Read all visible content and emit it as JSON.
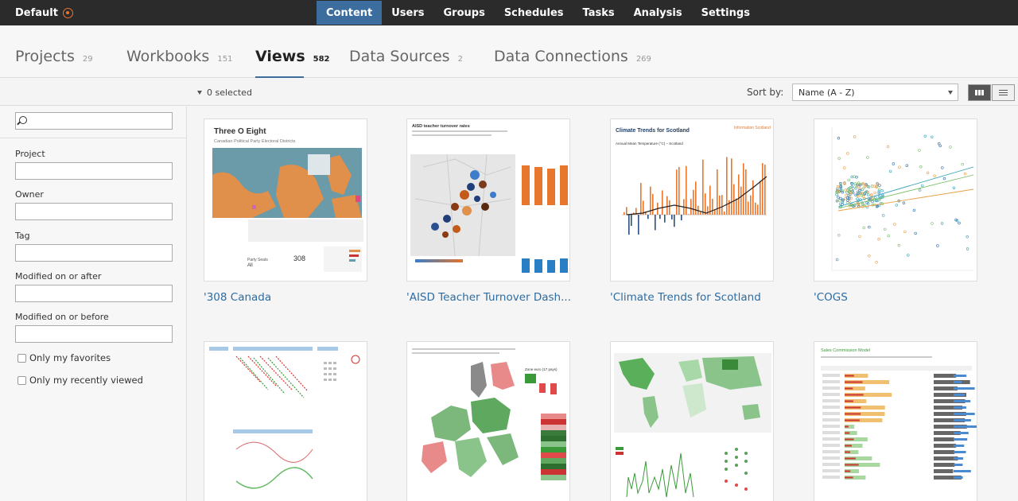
{
  "header": {
    "site": "Default",
    "nav": [
      "Content",
      "Users",
      "Groups",
      "Schedules",
      "Tasks",
      "Analysis",
      "Settings"
    ],
    "active_nav": "Content"
  },
  "tabs": [
    {
      "label": "Projects",
      "count": "29"
    },
    {
      "label": "Workbooks",
      "count": "151"
    },
    {
      "label": "Views",
      "count": "582",
      "active": true
    },
    {
      "label": "Data Sources",
      "count": "2"
    },
    {
      "label": "Data Connections",
      "count": "269"
    }
  ],
  "toolbar": {
    "selected": "0 selected",
    "sort_label": "Sort by:",
    "sort_value": "Name (A - Z)"
  },
  "filters": {
    "project": "Project",
    "owner": "Owner",
    "tag": "Tag",
    "modified_after": "Modified on or after",
    "modified_before": "Modified on or before",
    "favorites": "Only my favorites",
    "recently_viewed": "Only my recently viewed"
  },
  "views": [
    {
      "title": "'308 Canada",
      "thumb_title": "Three O Eight",
      "thumb_subtitle": "Canadian Political Party Electoral Districts"
    },
    {
      "title": "'AISD Teacher Turnover Dash...",
      "thumb_title": "AISD teacher turnover rates"
    },
    {
      "title": "'Climate Trends for Scotland",
      "thumb_title": "Climate Trends for Scotland",
      "thumb_subtitle": "Annual Mean Temperature (°C) – Scotland",
      "thumb_brand": "Information Scotland"
    },
    {
      "title": "'COGS"
    },
    {
      "title": ""
    },
    {
      "title": ""
    },
    {
      "title": ""
    },
    {
      "title": "",
      "thumb_title": "Sales Commission Model"
    }
  ],
  "colors": {
    "accent": "#3b6e9e",
    "link": "#2d6ca2",
    "topbar": "#2b2b2b",
    "orange": "#e8762c"
  }
}
